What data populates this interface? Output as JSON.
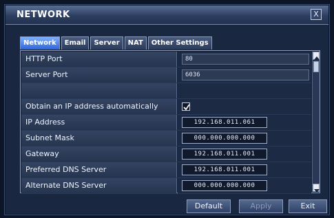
{
  "window": {
    "title": "NETWORK",
    "close_glyph": "X"
  },
  "tabs": [
    {
      "label": "Network",
      "active": true
    },
    {
      "label": "Email",
      "active": false
    },
    {
      "label": "Server",
      "active": false
    },
    {
      "label": "NAT",
      "active": false
    },
    {
      "label": "Other Settings",
      "active": false
    }
  ],
  "settings": {
    "http_port": {
      "label": "HTTP Port",
      "value": "80"
    },
    "server_port": {
      "label": "Server Port",
      "value": "6036"
    },
    "blank_row": {
      "label": ""
    },
    "dhcp": {
      "label": "Obtain an IP address automatically",
      "checked": true
    },
    "ip_address": {
      "label": "IP Address",
      "value": "192.168.011.061"
    },
    "subnet_mask": {
      "label": "Subnet Mask",
      "value": "000.000.000.000"
    },
    "gateway": {
      "label": "Gateway",
      "value": "192.168.011.001"
    },
    "preferred_dns": {
      "label": "Preferred DNS Server",
      "value": "192.168.011.001"
    },
    "alternate_dns": {
      "label": "Alternate DNS Server",
      "value": "000.000.000.000"
    }
  },
  "buttons": {
    "default": "Default",
    "apply": "Apply",
    "exit": "Exit"
  },
  "icons": {
    "close": "close-icon",
    "check": "checkmark-icon",
    "scroll_up": "scroll-up-arrow-icon",
    "scroll_down": "scroll-down-arrow-icon"
  },
  "colors": {
    "active_tab": "#2e64d8",
    "window_bg": "#1a2740",
    "titlebar": "#2c3e60"
  }
}
